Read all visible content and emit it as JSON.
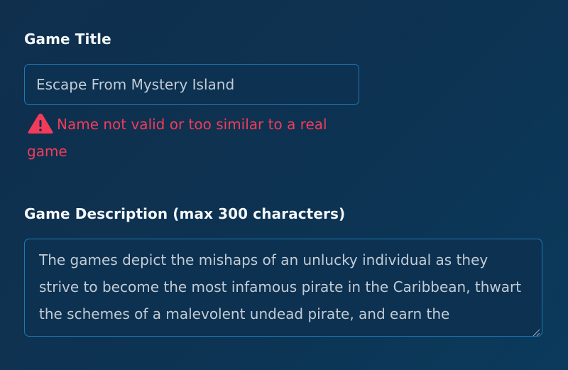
{
  "form": {
    "title_field": {
      "label": "Game Title",
      "value": "Escape From Mystery Island",
      "error": {
        "icon": "warning-triangle-icon",
        "message": "Name not valid or too similar to a real game",
        "color": "#f23b5a"
      }
    },
    "description_field": {
      "label": "Game Description (max 300 characters)",
      "value": "The games depict the mishaps of an unlucky individual as they strive to become the most infamous pirate in the Caribbean, thwart the schemes of a malevolent undead pirate, and earn the"
    }
  },
  "colors": {
    "background": "#0f2f4d",
    "field_border": "#1f78b6",
    "error": "#f23b5a",
    "label": "#f4f7fa",
    "field_text": "#c2ccd6"
  }
}
